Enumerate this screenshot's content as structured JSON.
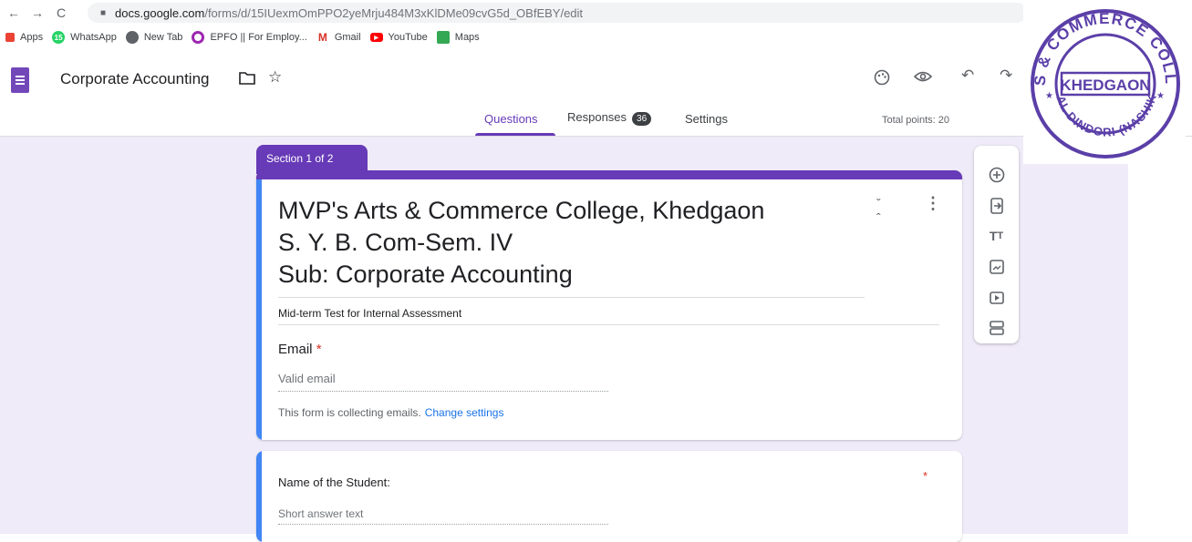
{
  "browser": {
    "nav": {
      "back": "←",
      "forward": "→",
      "reload": "C"
    },
    "url_host": "docs.google.com",
    "url_path": "/forms/d/15IUexmOmPPO2yeMrju484M3xKlDMe09cvG5d_OBfEBY/edit",
    "bookmarks": [
      {
        "label": "Apps",
        "icon": "apps-grid-icon",
        "color": "#ea4335"
      },
      {
        "label": "WhatsApp",
        "icon": "whatsapp-icon",
        "color": "#25d366"
      },
      {
        "label": "New Tab",
        "icon": "globe-icon",
        "color": "#5f6368"
      },
      {
        "label": "EPFO || For Employ...",
        "icon": "epfo-icon",
        "color": "#9c27b0"
      },
      {
        "label": "Gmail",
        "icon": "gmail-icon",
        "color": "#d93025"
      },
      {
        "label": "YouTube",
        "icon": "youtube-icon",
        "color": "#ff0000"
      },
      {
        "label": "Maps",
        "icon": "maps-icon",
        "color": "#34a853"
      }
    ]
  },
  "header": {
    "title": "Corporate Accounting",
    "tabs": {
      "questions": "Questions",
      "responses": "Responses",
      "responses_count": "36",
      "settings": "Settings"
    },
    "total_points": "Total points: 20"
  },
  "section_tab": "Section 1 of 2",
  "form": {
    "title_lines": [
      "MVP's Arts & Commerce College, Khedgaon",
      "S. Y. B. Com-Sem. IV",
      "Sub: Corporate Accounting"
    ],
    "description": "Mid-term Test for Internal Assessment",
    "email_label": "Email",
    "required_mark": "*",
    "email_placeholder": "Valid email",
    "collecting_text": "This form is collecting emails.",
    "change_settings": "Change settings"
  },
  "question": {
    "label": "Name of the Student:",
    "required_mark": "*",
    "placeholder": "Short answer text"
  },
  "stamp": {
    "outer_text": "ARTS & COMMERCE COLLEGE",
    "center_text": "KHEDGAON",
    "bottom_text": "TAL DINDORI (NASHIK)",
    "color": "#5b3fa8"
  },
  "colors": {
    "accent": "#673ab7",
    "background": "#f0ebf8",
    "focus_bar": "#4285f4"
  }
}
